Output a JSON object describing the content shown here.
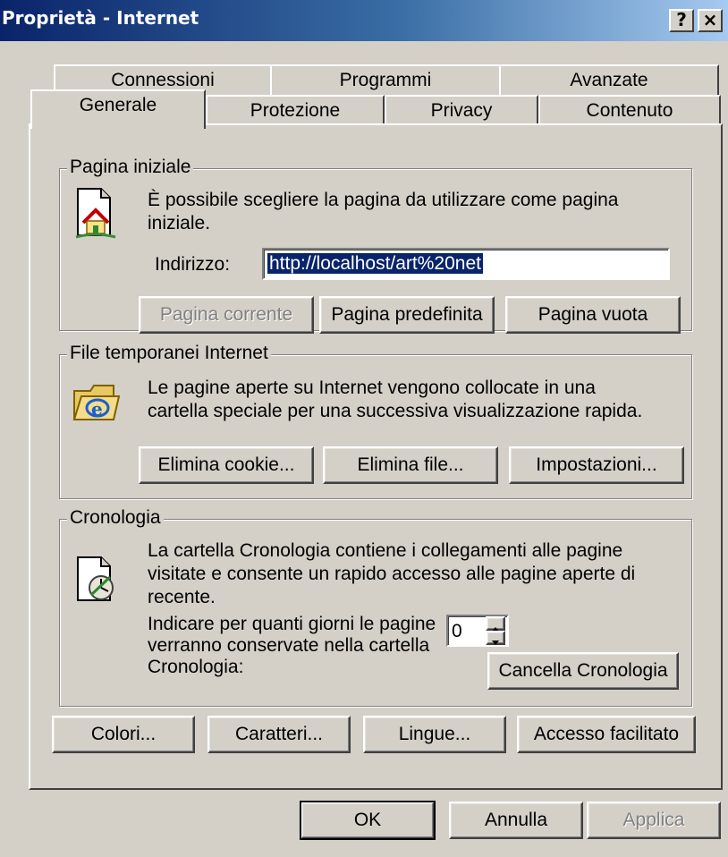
{
  "window": {
    "title": "Proprietà - Internet",
    "help": "?",
    "close": "×"
  },
  "tabs_row1": [
    "Connessioni",
    "Programmi",
    "Avanzate"
  ],
  "tabs_row2": [
    "Generale",
    "Protezione",
    "Privacy",
    "Contenuto"
  ],
  "home": {
    "legend": "Pagina iniziale",
    "desc_line1": "È possibile scegliere la pagina da utilizzare come pagina",
    "desc_line2": "iniziale.",
    "address_label": "Indirizzo:",
    "address_value": "http://localhost/art%20net",
    "btn_current": "Pagina corrente",
    "btn_default": "Pagina predefinita",
    "btn_blank": "Pagina vuota"
  },
  "temp": {
    "legend": "File temporanei Internet",
    "desc_line1": "Le pagine aperte su Internet vengono collocate in una",
    "desc_line2": "cartella speciale per una successiva visualizzazione rapida.",
    "btn_cookies": "Elimina cookie...",
    "btn_files": "Elimina file...",
    "btn_settings": "Impostazioni..."
  },
  "history": {
    "legend": "Cronologia",
    "desc_line1": "La cartella Cronologia contiene i collegamenti alle pagine",
    "desc_line2": "visitate e consente un rapido accesso alle pagine aperte di",
    "desc_line3": "recente.",
    "days_line1": "Indicare per quanti giorni le pagine",
    "days_line2": "verranno conservate nella cartella",
    "days_line3": "Cronologia:",
    "days_value": "0",
    "btn_clear": "Cancella Cronologia"
  },
  "bottom_buttons": {
    "colors": "Colori...",
    "fonts": "Caratteri...",
    "languages": "Lingue...",
    "accessibility": "Accesso facilitato"
  },
  "dialog_buttons": {
    "ok": "OK",
    "cancel": "Annulla",
    "apply": "Applica"
  }
}
